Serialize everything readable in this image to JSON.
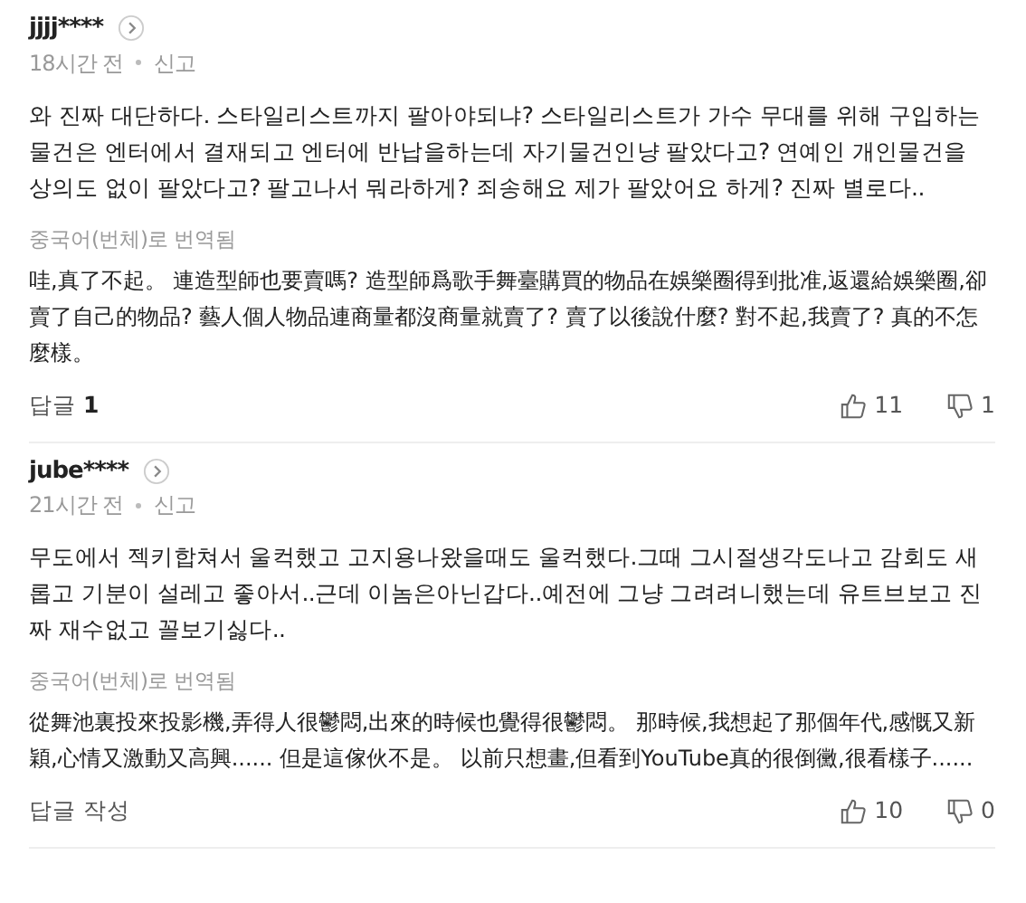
{
  "comments": [
    {
      "user": "jjjj****",
      "time": "18시간 전",
      "report": "신고",
      "text": "와 진짜 대단하다. 스타일리스트까지 팔아야되냐? 스타일리스트가 가수 무대를 위해 구입하는 물건은 엔터에서 결재되고 엔터에 반납을하는데 자기물건인냥 팔았다고? 연예인 개인물건을 상의도 없이 팔았다고? 팔고나서 뭐라하게? 죄송해요 제가 팔았어요 하게? 진짜 별로다..",
      "translated_label": "중국어(번체)로 번역됨",
      "translation": "哇,真了不起。 連造型師也要賣嗎? 造型師爲歌手舞臺購買的物品在娛樂圈得到批准,返還給娛樂圈,卻賣了自己的物品? 藝人個人物品連商量都沒商量就賣了? 賣了以後說什麼? 對不起,我賣了? 真的不怎麼樣。",
      "reply_label": "답글",
      "reply_count": "1",
      "likes": "11",
      "dislikes": "1"
    },
    {
      "user": "jube****",
      "time": "21시간 전",
      "report": "신고",
      "text": "무도에서 젝키합쳐서 울컥했고 고지용나왔을때도 울컥했다.그때 그시절생각도나고 감회도 새롭고 기분이 설레고 좋아서..근데 이놈은아닌갑다..예전에 그냥 그려려니했는데 유트브보고 진짜 재수없고 꼴보기싫다..",
      "translated_label": "중국어(번체)로 번역됨",
      "translation": "從舞池裏投來投影機,弄得人很鬱悶,出來的時候也覺得很鬱悶。 那時候,我想起了那個年代,感慨又新穎,心情又激動又高興...... 但是這傢伙不是。 以前只想畫,但看到YouTube真的很倒黴,很看樣子......",
      "reply_label": "답글 작성",
      "likes": "10",
      "dislikes": "0"
    }
  ]
}
